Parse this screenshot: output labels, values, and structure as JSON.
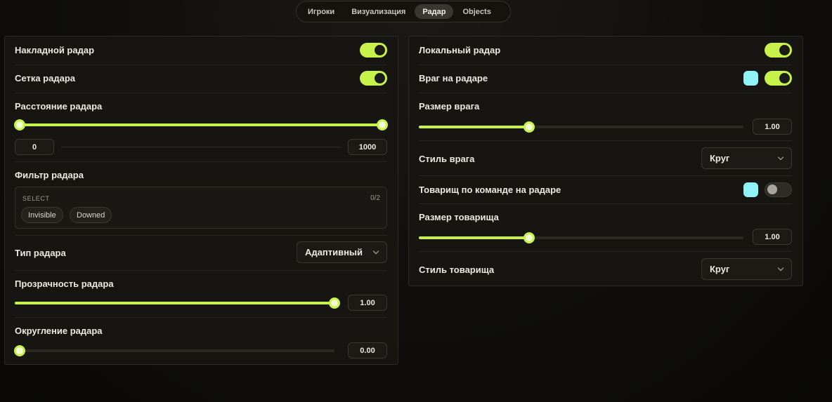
{
  "tabs": [
    {
      "label": "Игроки",
      "active": false
    },
    {
      "label": "Визуализация",
      "active": false
    },
    {
      "label": "Радар",
      "active": true
    },
    {
      "label": "Objects",
      "active": false
    }
  ],
  "left": {
    "overlay_radar": {
      "label": "Накладной радар",
      "enabled": true
    },
    "radar_grid": {
      "label": "Сетка радара",
      "enabled": true
    },
    "radar_distance": {
      "label": "Расстояние радара",
      "min_value": "0",
      "max_value": "1000",
      "range_start": 0,
      "range_end": 1
    },
    "radar_filter": {
      "label": "Фильтр радара",
      "select_title": "SELECT",
      "count": "0/2",
      "options": [
        "Invisible",
        "Downed"
      ]
    },
    "radar_type": {
      "label": "Тип радара",
      "value": "Адаптивный"
    },
    "radar_opacity": {
      "label": "Прозрачность радара",
      "value": "1.00",
      "fraction": 1.0
    },
    "radar_rounding": {
      "label": "Округление радара",
      "value": "0.00",
      "fraction": 0.0
    }
  },
  "right": {
    "local_radar": {
      "label": "Локальный радар",
      "enabled": true
    },
    "enemy_on_radar": {
      "label": "Враг на радаре",
      "enabled": true,
      "color": "#8ff2f6"
    },
    "enemy_size": {
      "label": "Размер врага",
      "value": "1.00",
      "fraction": 0.34
    },
    "enemy_style": {
      "label": "Стиль врага",
      "value": "Круг"
    },
    "teammate_on_radar": {
      "label": "Товарищ по команде на радаре",
      "enabled": false,
      "color": "#8ff2f6"
    },
    "teammate_size": {
      "label": "Размер товарища",
      "value": "1.00",
      "fraction": 0.34
    },
    "teammate_style": {
      "label": "Стиль товарища",
      "value": "Круг"
    }
  },
  "colors": {
    "accent": "#c7f24a",
    "swatch": "#8ff2f6"
  }
}
